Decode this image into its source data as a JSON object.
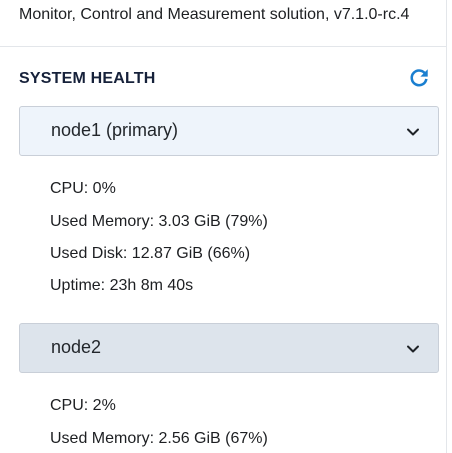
{
  "header": {
    "app_version": "Monitor, Control and Measurement solution, v7.1.0-rc.4"
  },
  "system_health": {
    "title": "SYSTEM HEALTH",
    "refresh_icon": "refresh-icon",
    "accent_color": "#1a7fd0",
    "nodes": [
      {
        "name": "node1 (primary)",
        "expanded": true,
        "stats": [
          "CPU: 0%",
          "Used Memory: 3.03 GiB (79%)",
          "Used Disk: 12.87 GiB (66%)",
          "Uptime: 23h 8m 40s"
        ]
      },
      {
        "name": "node2",
        "expanded": true,
        "stats": [
          "CPU: 2%",
          "Used Memory: 2.56 GiB (67%)"
        ]
      }
    ]
  }
}
